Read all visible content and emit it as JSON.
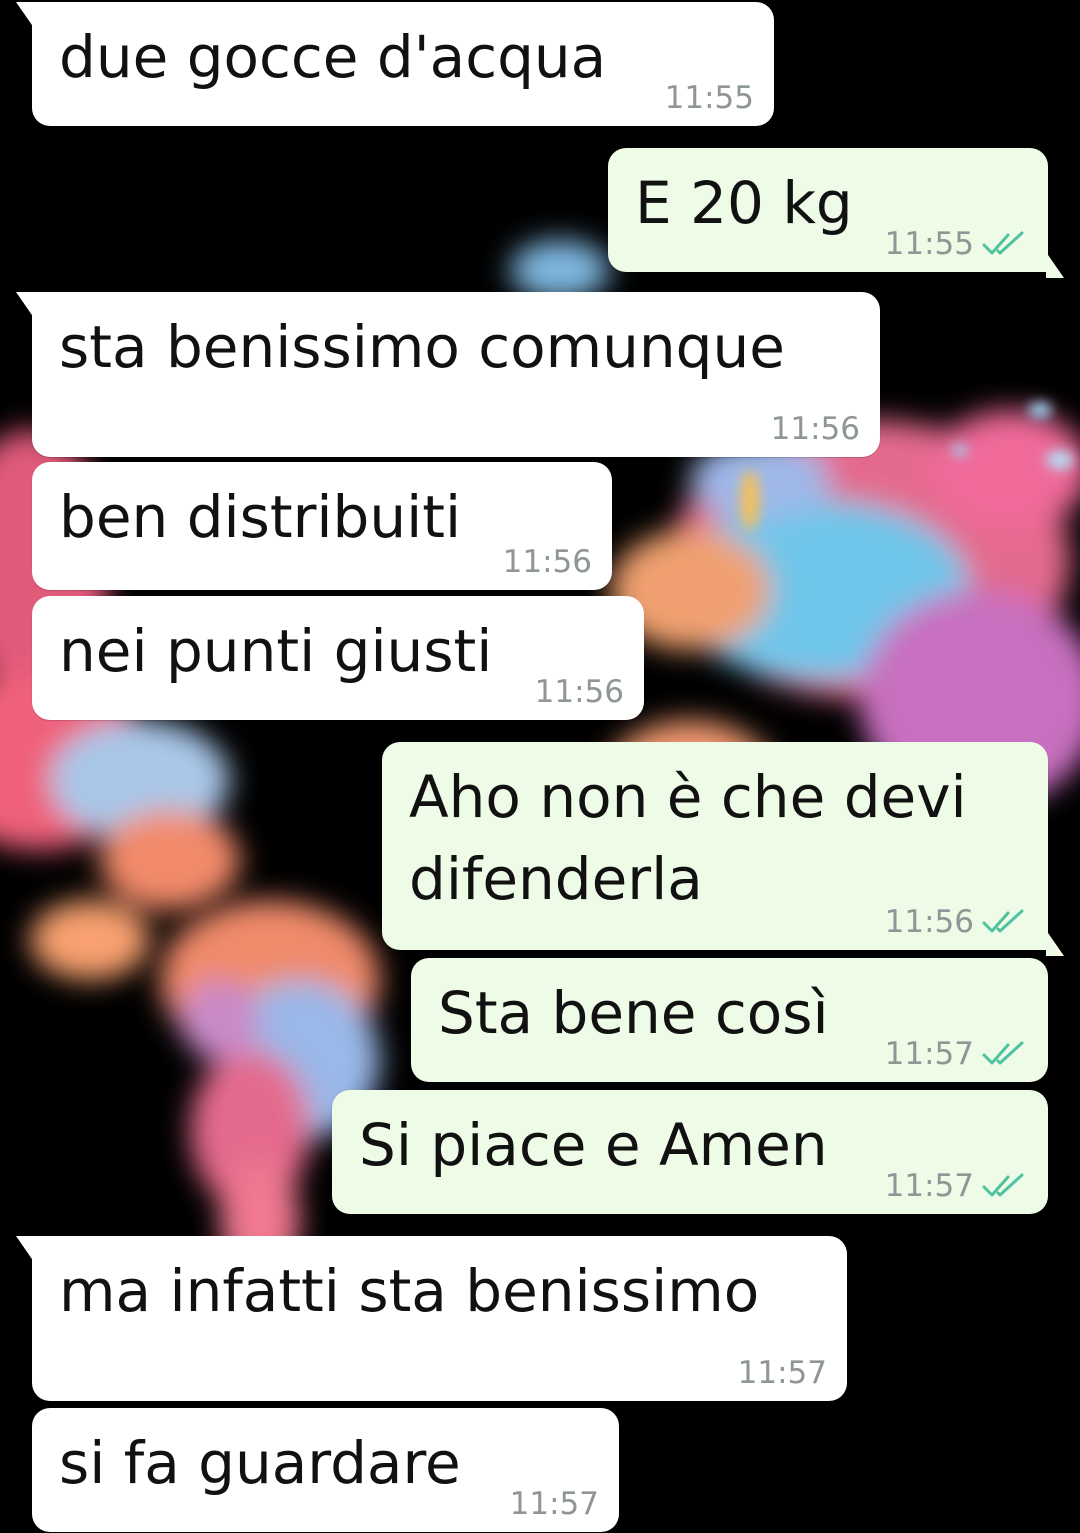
{
  "chat": {
    "messages": [
      {
        "direction": "incoming",
        "text": "due gocce d'acqua",
        "time": "11:55",
        "ticks": false
      },
      {
        "direction": "outgoing",
        "text": "E 20 kg",
        "time": "11:55",
        "ticks": true
      },
      {
        "direction": "incoming",
        "text": "sta benissimo comunque",
        "time": "11:56",
        "ticks": false
      },
      {
        "direction": "incoming",
        "text": "ben distribuiti",
        "time": "11:56",
        "ticks": false
      },
      {
        "direction": "incoming",
        "text": "nei punti giusti",
        "time": "11:56",
        "ticks": false
      },
      {
        "direction": "outgoing",
        "text": "Aho non è che devi\ndifenderla",
        "time": "11:56",
        "ticks": true
      },
      {
        "direction": "outgoing",
        "text": "Sta bene così",
        "time": "11:57",
        "ticks": true
      },
      {
        "direction": "outgoing",
        "text": "Si piace e Amen",
        "time": "11:57",
        "ticks": true
      },
      {
        "direction": "incoming",
        "text": "ma infatti sta benissimo",
        "time": "11:57",
        "ticks": false
      },
      {
        "direction": "incoming",
        "text": "si fa guardare",
        "time": "11:57",
        "ticks": false
      }
    ],
    "read_receipt_icon": "double-check-icon",
    "tick_color": "#4fc3a1",
    "incoming_bubble_color": "#ffffff",
    "outgoing_bubble_color": "#eefbe6",
    "wallpaper": "world-map-wallpaper"
  }
}
